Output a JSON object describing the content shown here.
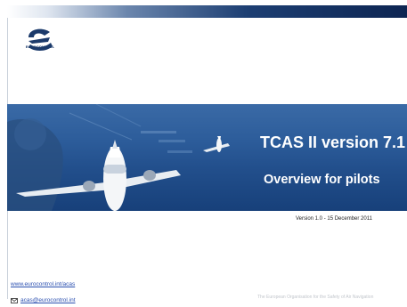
{
  "header": {
    "logo_text": "EUROCONTROL"
  },
  "banner": {
    "title": "TCAS II version 7.1",
    "subtitle": "Overview for pilots"
  },
  "version_line": "Version 1.0 -  15 December 2011",
  "links": {
    "website": "www.eurocontrol.int/acas",
    "email": "acas@eurocontrol.int"
  },
  "footer": {
    "org_text": "The European Organisation for the Safety of Air Navigation"
  },
  "icons": {
    "logo": "eurocontrol-logo",
    "envelope": "envelope-icon"
  },
  "colors": {
    "brand_navy": "#1b3a6b",
    "banner_blue": "#2c5c9a",
    "link": "#2a4fb0"
  }
}
